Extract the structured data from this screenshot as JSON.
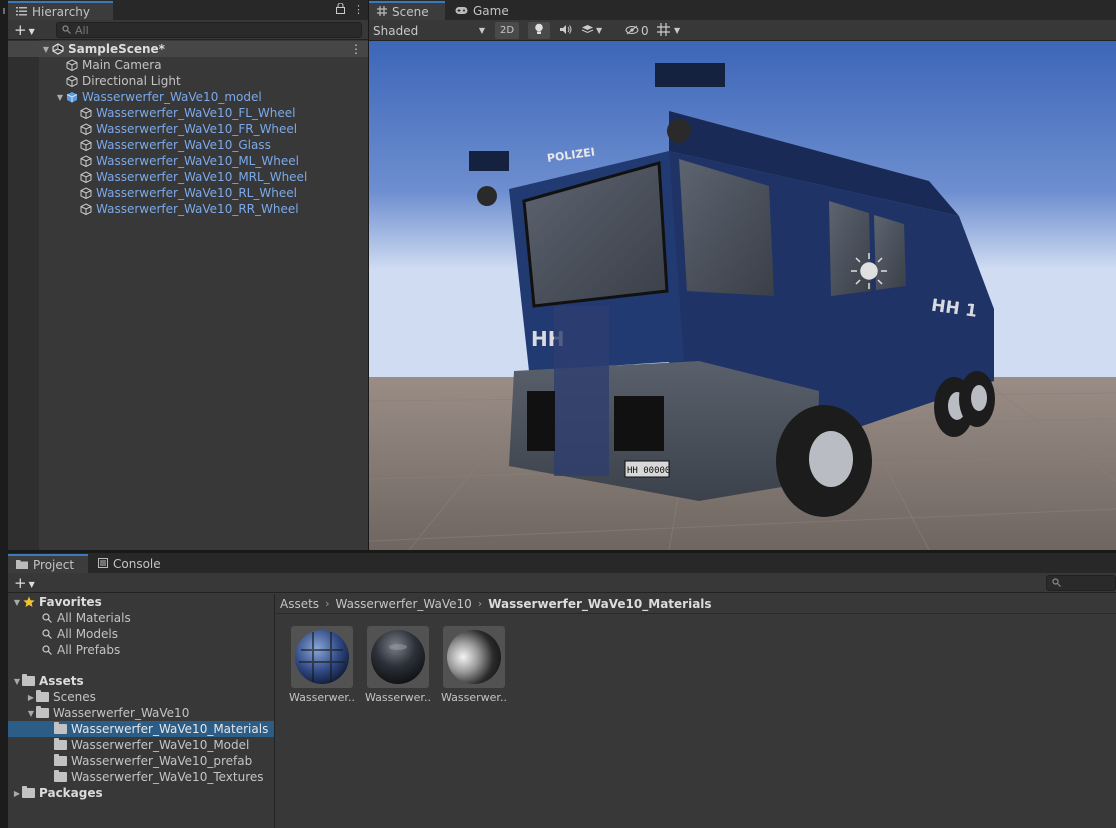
{
  "hierarchy": {
    "tab_label": "Hierarchy",
    "search_placeholder": "All",
    "scene_name": "SampleScene*",
    "items": [
      {
        "label": "Main Camera"
      },
      {
        "label": "Directional Light"
      },
      {
        "label": "Wasserwerfer_WaVe10_model"
      },
      {
        "label": "Wasserwerfer_WaVe10_FL_Wheel"
      },
      {
        "label": "Wasserwerfer_WaVe10_FR_Wheel"
      },
      {
        "label": "Wasserwerfer_WaVe10_Glass"
      },
      {
        "label": "Wasserwerfer_WaVe10_ML_Wheel"
      },
      {
        "label": "Wasserwerfer_WaVe10_MRL_Wheel"
      },
      {
        "label": "Wasserwerfer_WaVe10_RL_Wheel"
      },
      {
        "label": "Wasserwerfer_WaVe10_RR_Wheel"
      }
    ]
  },
  "scene": {
    "tabs": [
      {
        "label": "Scene"
      },
      {
        "label": "Game"
      }
    ],
    "toolbar": {
      "shading_mode": "Shaded",
      "mode_2d": "2D",
      "hidden_count": "0"
    },
    "vehicle": {
      "roof_text": "POLIZEI",
      "front_text": "HH",
      "side_text": "HH 1",
      "plate": "HH 00000"
    }
  },
  "project": {
    "tabs": [
      {
        "label": "Project"
      },
      {
        "label": "Console"
      }
    ],
    "favorites": {
      "label": "Favorites",
      "items": [
        {
          "label": "All Materials"
        },
        {
          "label": "All Models"
        },
        {
          "label": "All Prefabs"
        }
      ]
    },
    "assets": {
      "label": "Assets",
      "items": [
        {
          "label": "Scenes"
        },
        {
          "label": "Wasserwerfer_WaVe10"
        },
        {
          "label": "Wasserwerfer_WaVe10_Materials"
        },
        {
          "label": "Wasserwerfer_WaVe10_Model"
        },
        {
          "label": "Wasserwerfer_WaVe10_prefab"
        },
        {
          "label": "Wasserwerfer_WaVe10_Textures"
        }
      ]
    },
    "packages_label": "Packages",
    "breadcrumb": [
      "Assets",
      "Wasserwerfer_WaVe10",
      "Wasserwerfer_WaVe10_Materials"
    ],
    "asset_grid": [
      {
        "name": "Wasserwer..."
      },
      {
        "name": "Wasserwer..."
      },
      {
        "name": "Wasserwer..."
      }
    ]
  },
  "colors": {
    "accent_blue": "#3a79bb",
    "prefab_text": "#7ba9ea",
    "selection": "#2c5d87",
    "panel_bg": "#383838",
    "sky_top": "#3d66b8",
    "ground": "#776d68",
    "truck_body": "#1f3366"
  }
}
